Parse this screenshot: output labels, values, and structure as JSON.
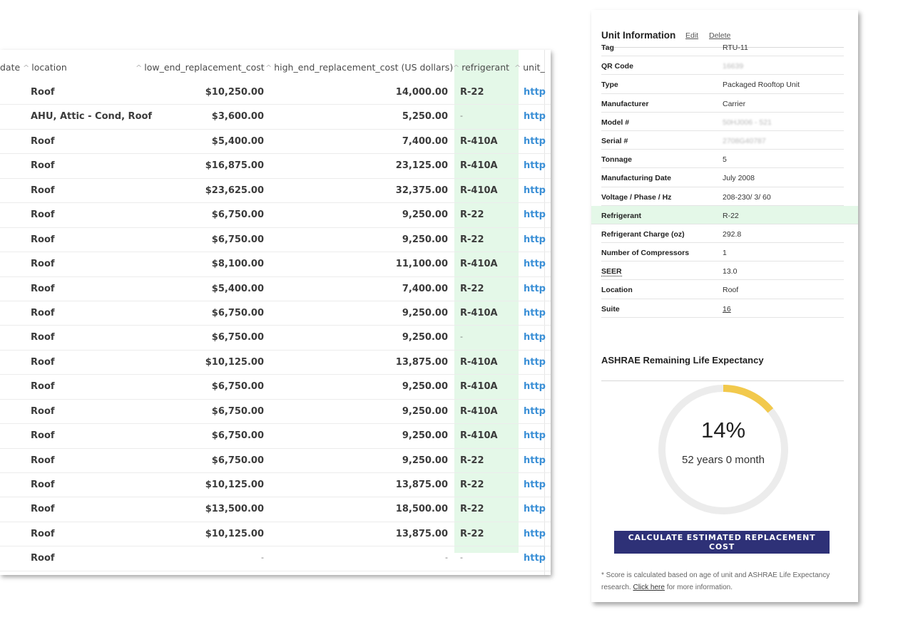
{
  "table": {
    "headers": {
      "date": "date",
      "location": "location",
      "low": "low_end_replacement_cost",
      "high": "high_end_replacement_cost (US dollars)",
      "refrigerant": "refrigerant",
      "url": "unit_"
    },
    "rows": [
      {
        "location": "Roof",
        "low": "$10,250.00",
        "high": "14,000.00",
        "refrigerant": "R-22",
        "url": "http"
      },
      {
        "location": "AHU, Attic - Cond, Roof",
        "low": "$3,600.00",
        "high": "5,250.00",
        "refrigerant": "-",
        "url": "http"
      },
      {
        "location": "Roof",
        "low": "$5,400.00",
        "high": "7,400.00",
        "refrigerant": "R-410A",
        "url": "http"
      },
      {
        "location": "Roof",
        "low": "$16,875.00",
        "high": "23,125.00",
        "refrigerant": "R-410A",
        "url": "http"
      },
      {
        "location": "Roof",
        "low": "$23,625.00",
        "high": "32,375.00",
        "refrigerant": "R-410A",
        "url": "http"
      },
      {
        "location": "Roof",
        "low": "$6,750.00",
        "high": "9,250.00",
        "refrigerant": "R-22",
        "url": "http"
      },
      {
        "location": "Roof",
        "low": "$6,750.00",
        "high": "9,250.00",
        "refrigerant": "R-22",
        "url": "http"
      },
      {
        "location": "Roof",
        "low": "$8,100.00",
        "high": "11,100.00",
        "refrigerant": "R-410A",
        "url": "http"
      },
      {
        "location": "Roof",
        "low": "$5,400.00",
        "high": "7,400.00",
        "refrigerant": "R-22",
        "url": "http"
      },
      {
        "location": "Roof",
        "low": "$6,750.00",
        "high": "9,250.00",
        "refrigerant": "R-410A",
        "url": "http"
      },
      {
        "location": "Roof",
        "low": "$6,750.00",
        "high": "9,250.00",
        "refrigerant": "-",
        "url": "http"
      },
      {
        "location": "Roof",
        "low": "$10,125.00",
        "high": "13,875.00",
        "refrigerant": "R-410A",
        "url": "http"
      },
      {
        "location": "Roof",
        "low": "$6,750.00",
        "high": "9,250.00",
        "refrigerant": "R-410A",
        "url": "http"
      },
      {
        "location": "Roof",
        "low": "$6,750.00",
        "high": "9,250.00",
        "refrigerant": "R-410A",
        "url": "http"
      },
      {
        "location": "Roof",
        "low": "$6,750.00",
        "high": "9,250.00",
        "refrigerant": "R-410A",
        "url": "http"
      },
      {
        "location": "Roof",
        "low": "$6,750.00",
        "high": "9,250.00",
        "refrigerant": "R-22",
        "url": "http"
      },
      {
        "location": "Roof",
        "low": "$10,125.00",
        "high": "13,875.00",
        "refrigerant": "R-22",
        "url": "http"
      },
      {
        "location": "Roof",
        "low": "$13,500.00",
        "high": "18,500.00",
        "refrigerant": "R-22",
        "url": "http"
      },
      {
        "location": "Roof",
        "low": "$10,125.00",
        "high": "13,875.00",
        "refrigerant": "R-22",
        "url": "http"
      },
      {
        "location": "Roof",
        "low": "-",
        "high": "-",
        "refrigerant": "-",
        "url": "http"
      }
    ]
  },
  "unit": {
    "title": "Unit Information",
    "edit_label": "Edit",
    "delete_label": "Delete",
    "fields": [
      {
        "label": "Tag",
        "value": "RTU-11"
      },
      {
        "label": "QR Code",
        "value": "16639"
      },
      {
        "label": "Type",
        "value": "Packaged Rooftop Unit"
      },
      {
        "label": "Manufacturer",
        "value": "Carrier"
      },
      {
        "label": "Model #",
        "value": "50HJ006 - 521"
      },
      {
        "label": "Serial #",
        "value": "2708G40787"
      },
      {
        "label": "Tonnage",
        "value": "5"
      },
      {
        "label": "Manufacturing Date",
        "value": "July 2008"
      },
      {
        "label": "Voltage / Phase / Hz",
        "value": "208-230/ 3/ 60"
      },
      {
        "label": "Refrigerant",
        "value": "R-22"
      },
      {
        "label": "Refrigerant Charge (oz)",
        "value": "292.8"
      },
      {
        "label": "Number of Compressors",
        "value": "1"
      },
      {
        "label": "SEER",
        "value": "13.0"
      },
      {
        "label": "Location",
        "value": "Roof"
      },
      {
        "label": "Suite",
        "value": "16"
      }
    ]
  },
  "ashrae": {
    "title": "ASHRAE Remaining Life Expectancy",
    "percent_label": "14%",
    "percent_value": 0.14,
    "remaining": "52 years 0 month",
    "button_label": "CALCULATE ESTIMATED REPLACEMENT COST",
    "footnote_pre": "* Score is calculated based on age of unit and ASHRAE Life Expectancy research. ",
    "footnote_link": "Click here",
    "footnote_post": " for more information.",
    "gauge_color": "#f2c94c",
    "track_color": "#ececec"
  },
  "colors": {
    "highlight": "#e4f8e8",
    "link": "#3a8fd6",
    "button": "#2e3177"
  },
  "icons": {
    "sort": "sort-caret-icon"
  }
}
